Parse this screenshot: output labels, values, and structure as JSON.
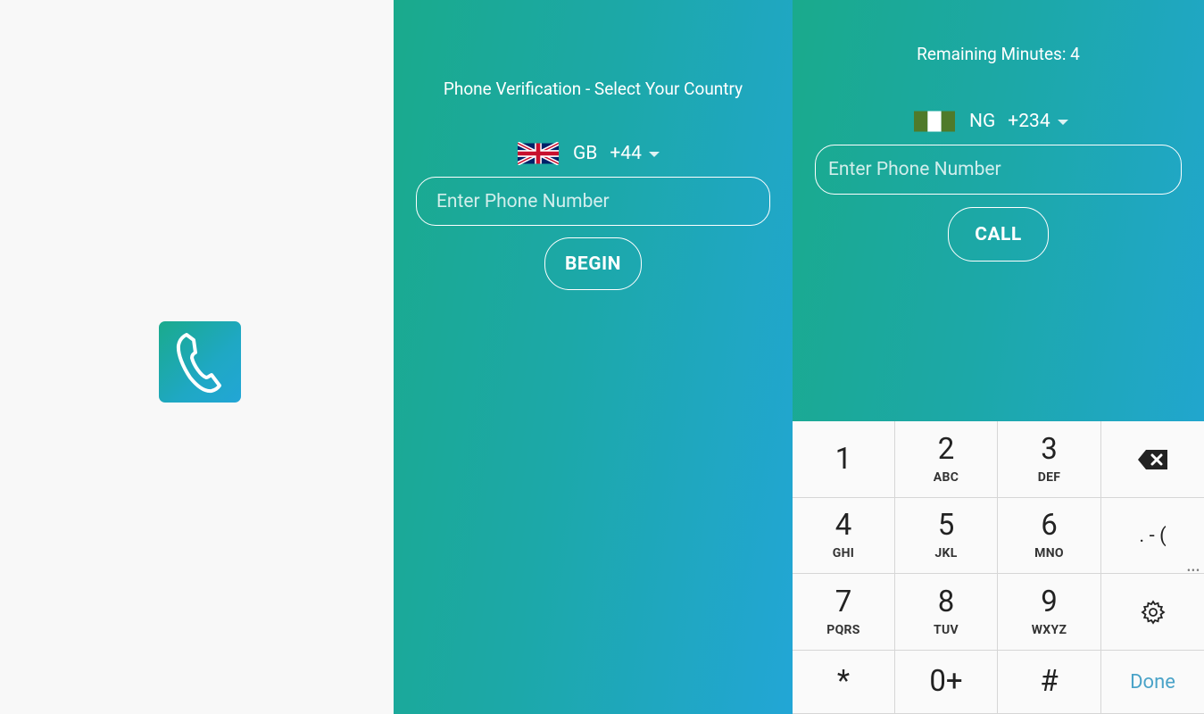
{
  "colors": {
    "gradient_start": "#1aaa8c",
    "gradient_end": "#22a6d6",
    "splash_bg": "#f8f8f8",
    "done_text": "#4aa3c8"
  },
  "splash": {
    "app_icon": "phone-handset-icon"
  },
  "verify_screen": {
    "title": "Phone Verification - Select Your Country",
    "country": {
      "flag": "gb-flag-icon",
      "code": "GB",
      "dial": "+44"
    },
    "phone_placeholder": "Enter Phone Number",
    "begin_label": "BEGIN"
  },
  "call_screen": {
    "remaining": "Remaining Minutes: 4",
    "country": {
      "flag": "ng-flag-icon",
      "code": "NG",
      "dial": "+234"
    },
    "phone_placeholder": "Enter Phone Number",
    "call_label": "CALL"
  },
  "keypad": {
    "keys": [
      {
        "digit": "1",
        "letters": ""
      },
      {
        "digit": "2",
        "letters": "ABC"
      },
      {
        "digit": "3",
        "letters": "DEF"
      },
      {
        "digit": "4",
        "letters": "GHI"
      },
      {
        "digit": "5",
        "letters": "JKL"
      },
      {
        "digit": "6",
        "letters": "MNO"
      },
      {
        "digit": "7",
        "letters": "PQRS"
      },
      {
        "digit": "8",
        "letters": "TUV"
      },
      {
        "digit": "9",
        "letters": "WXYZ"
      },
      {
        "digit": "*",
        "letters": ""
      },
      {
        "digit": "0+",
        "letters": ""
      },
      {
        "digit": "#",
        "letters": ""
      }
    ],
    "punct_label": ". - (",
    "done_label": "Done",
    "more_dots": "•••"
  }
}
